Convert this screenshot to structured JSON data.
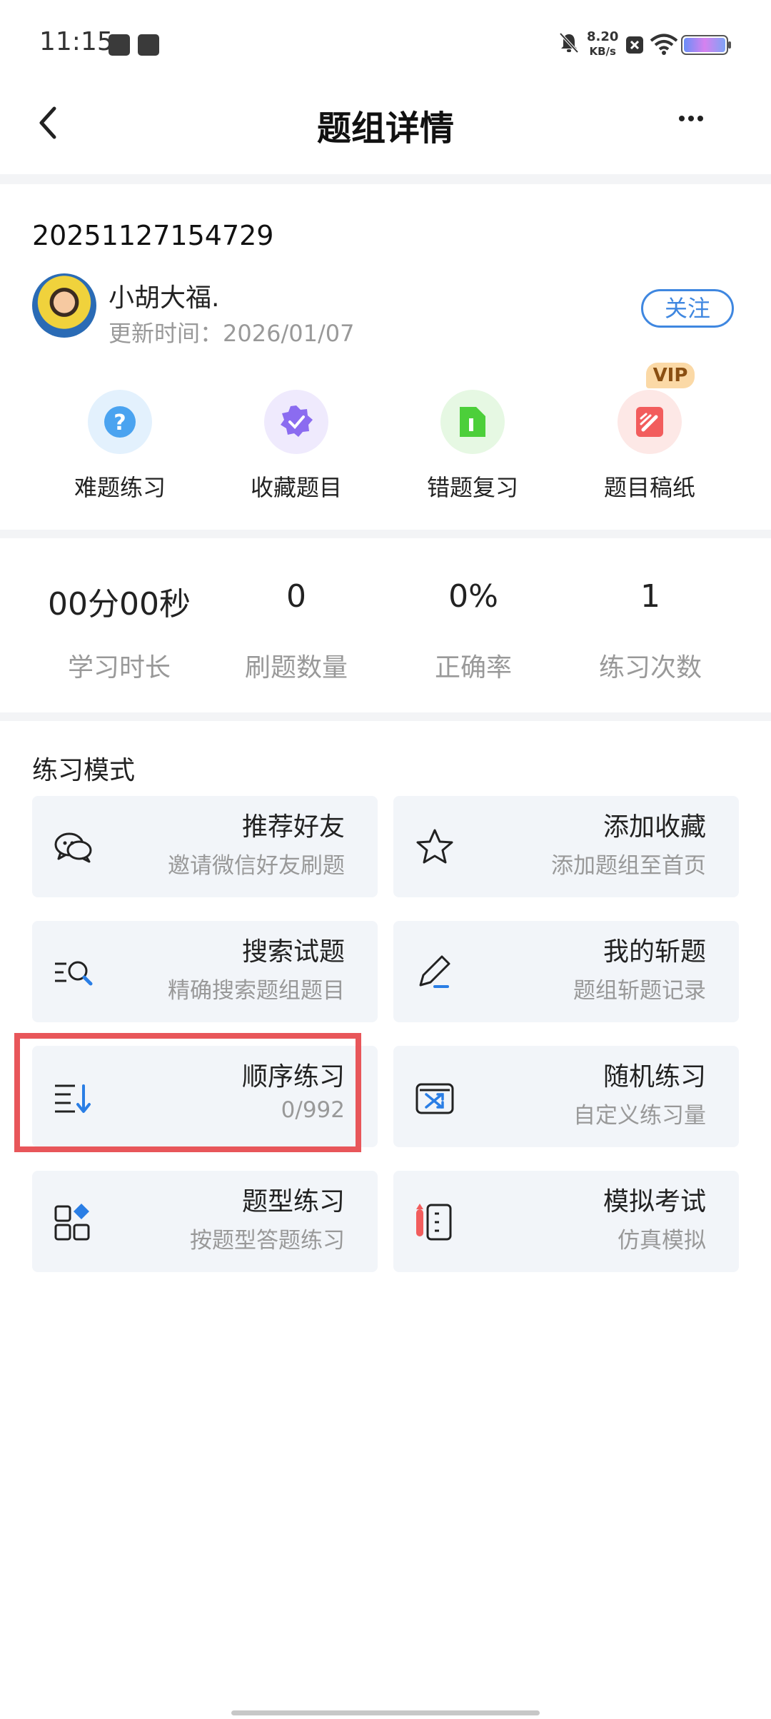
{
  "status_bar": {
    "time": "11:15",
    "net_speed_value": "8.20",
    "net_speed_unit": "KB/s"
  },
  "header": {
    "title": "题组详情"
  },
  "group": {
    "id": "20251127154729",
    "author": "小胡大福.",
    "update_time": "更新时间：2026/01/07",
    "follow_label": "关注"
  },
  "quick_actions": [
    {
      "label": "难题练习",
      "icon": "question-icon",
      "color": "#4aa3f0"
    },
    {
      "label": "收藏题目",
      "icon": "favorite-badge-icon",
      "color": "#8b6cf0"
    },
    {
      "label": "错题复习",
      "icon": "document-icon",
      "color": "#4ccf3a"
    },
    {
      "label": "题目稿纸",
      "icon": "scratch-paper-icon",
      "color": "#f25d5d",
      "badge": "VIP"
    }
  ],
  "stats": [
    {
      "value": "00分00秒",
      "label": "学习时长"
    },
    {
      "value": "0",
      "label": "刷题数量"
    },
    {
      "value": "0%",
      "label": "正确率"
    },
    {
      "value": "1",
      "label": "练习次数"
    }
  ],
  "practice": {
    "section_title": "练习模式",
    "cards": [
      {
        "title": "推荐好友",
        "subtitle": "邀请微信好友刷题",
        "icon": "chat-icon"
      },
      {
        "title": "添加收藏",
        "subtitle": "添加题组至首页",
        "icon": "star-icon"
      },
      {
        "title": "搜索试题",
        "subtitle": "精确搜索题组题目",
        "icon": "search-list-icon"
      },
      {
        "title": "我的斩题",
        "subtitle": "题组斩题记录",
        "icon": "knife-icon"
      },
      {
        "title": "顺序练习",
        "subtitle": "0/992",
        "icon": "sequence-icon"
      },
      {
        "title": "随机练习",
        "subtitle": "自定义练习量",
        "icon": "shuffle-icon"
      },
      {
        "title": "题型练习",
        "subtitle": "按题型答题练习",
        "icon": "category-icon"
      },
      {
        "title": "模拟考试",
        "subtitle": "仿真模拟",
        "icon": "exam-notebook-icon"
      }
    ]
  },
  "colors": {
    "accent": "#3f87e0",
    "highlight": "#e8565a",
    "card_bg": "#f2f5f9"
  }
}
